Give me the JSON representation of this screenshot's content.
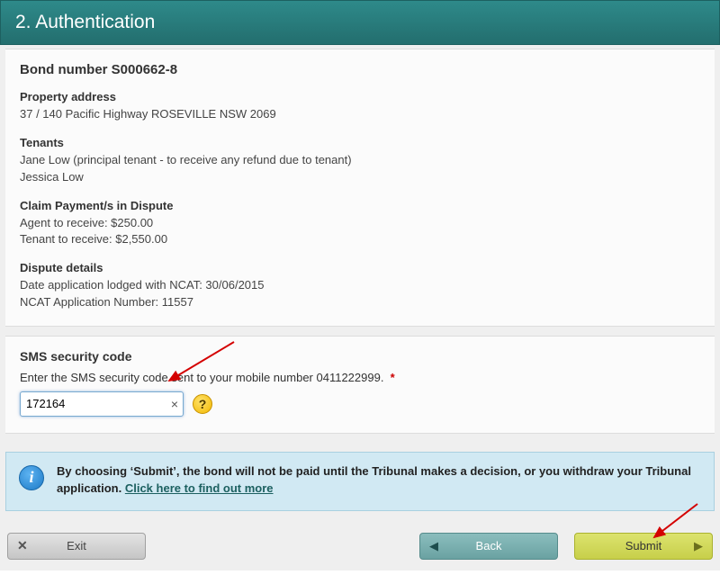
{
  "header": {
    "title": "2. Authentication"
  },
  "bond": {
    "bond_number_label": "Bond number S000662-8",
    "property_address_label": "Property address",
    "property_address": "37 / 140 Pacific Highway ROSEVILLE NSW 2069",
    "tenants_label": "Tenants",
    "tenant1": "Jane Low (principal tenant - to receive any refund due to tenant)",
    "tenant2": "Jessica Low",
    "claim_label": "Claim Payment/s in Dispute",
    "agent_to_receive": "Agent to receive: $250.00",
    "tenant_to_receive": "Tenant to receive: $2,550.00",
    "dispute_label": "Dispute details",
    "dispute_date": "Date application lodged with NCAT: 30/06/2015",
    "ncat_number": "NCAT Application Number: 11557"
  },
  "sms": {
    "title": "SMS security code",
    "instruction": "Enter the SMS security code sent to your mobile number 0411222999.",
    "required_mark": "*",
    "code_value": "172164",
    "clear_glyph": "×",
    "help_glyph": "?"
  },
  "info": {
    "icon_glyph": "i",
    "text_before_link": "By choosing ‘Submit’, the bond will not be paid until the Tribunal makes a decision, or you withdraw your Tribunal application. ",
    "link_text": "Click here to find out more"
  },
  "buttons": {
    "exit": "Exit",
    "exit_icon": "✕",
    "back": "Back",
    "back_icon": "◀",
    "submit": "Submit",
    "submit_icon": "▶"
  }
}
